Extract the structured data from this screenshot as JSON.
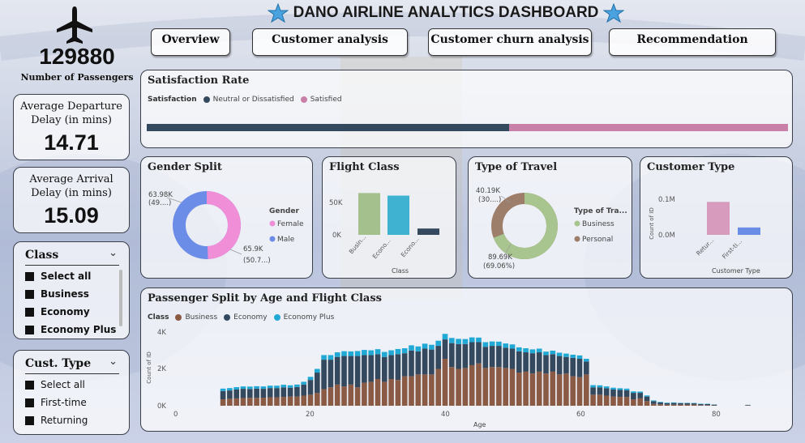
{
  "header": {
    "title": "DANO AIRLINE ANALYTICS DASHBOARD"
  },
  "nav": [
    "Overview",
    "Customer analysis",
    "Customer churn analysis",
    "Recommendation"
  ],
  "passengers": {
    "value": "129880",
    "label": "Number of Passengers"
  },
  "kpis": {
    "departure": {
      "label1": "Average Departure",
      "label2": "Delay (in mins)",
      "value": "14.71"
    },
    "arrival": {
      "label1": "Average Arrival",
      "label2": "Delay (in mins)",
      "value": "15.09"
    }
  },
  "slicer_class": {
    "title": "Class",
    "items": [
      "Select all",
      "Business",
      "Economy",
      "Economy Plus"
    ]
  },
  "slicer_cust": {
    "title": "Cust. Type",
    "items": [
      "Select all",
      "First-time",
      "Returning"
    ]
  },
  "satisfaction": {
    "title": "Satisfaction Rate",
    "legend_title": "Satisfaction",
    "legend": [
      "Neutral or Dissatisfied",
      "Satisfied"
    ],
    "neutral_fraction": 0.565
  },
  "gender": {
    "title": "Gender Split",
    "legend_title": "Gender",
    "legend": [
      "Female",
      "Male"
    ],
    "label_top": "63.98K",
    "label_top2": "(49....)",
    "label_bottom": "65.9K",
    "label_bottom2": "(50.7...)",
    "female_fraction": 0.493
  },
  "flight_class": {
    "title": "Flight Class",
    "xlabel": "Class",
    "yticks": [
      "50K",
      "0K"
    ],
    "cats": [
      "Busin...",
      "Econo...",
      "Econo..."
    ]
  },
  "travel": {
    "title": "Type of Travel",
    "legend_title": "Type of Tra...",
    "legend": [
      "Business",
      "Personal"
    ],
    "label_top": "40.19K",
    "label_top2": "(30....)",
    "label_bottom": "89.69K",
    "label_bottom2": "(69.06%)",
    "business_fraction": 0.6906
  },
  "customer_type": {
    "title": "Customer Type",
    "xlabel": "Customer Type",
    "ylabel": "Count of ID",
    "yticks": [
      "0.1M",
      "0.0M"
    ],
    "cats": [
      "Retur...",
      "First-ti..."
    ]
  },
  "age_chart": {
    "title": "Passenger Split by Age and Flight Class",
    "legend_title": "Class",
    "legend": [
      "Business",
      "Economy",
      "Economy Plus"
    ],
    "xlabel": "Age",
    "ylabel": "Count of ID",
    "yticks": [
      "4K",
      "2K",
      "0K"
    ],
    "xticks": [
      "0",
      "20",
      "40",
      "60",
      "80"
    ]
  },
  "colors": {
    "neutral": "#34495e",
    "satisfied": "#c87fa8",
    "female": "#f08fd8",
    "male": "#6b8de8",
    "cls_business": "#a4c08c",
    "cls_economy": "#3fb1d1",
    "cls_ecoplus": "#34495e",
    "travel_business": "#a8c48f",
    "travel_personal": "#9c7e6b",
    "returning": "#d79cbd",
    "first": "#6b8de8",
    "age_business": "#8a5a44",
    "age_economy": "#34495e",
    "age_ecoplus": "#21a9d6"
  },
  "chart_data": [
    {
      "type": "bar",
      "title": "Flight Class",
      "categories": [
        "Busin...",
        "Econo...",
        "Econo..."
      ],
      "values": [
        62160,
        58309,
        9411
      ],
      "xlabel": "Class",
      "ylim": [
        0,
        65000
      ]
    },
    {
      "type": "bar",
      "title": "Customer Type",
      "categories": [
        "Retur...",
        "First-ti..."
      ],
      "values": [
        106100,
        23780
      ],
      "xlabel": "Customer Type",
      "ylabel": "Count of ID",
      "ylim": [
        0,
        125000
      ]
    },
    {
      "type": "bar",
      "title": "Passenger Split by Age and Flight Class",
      "xlabel": "Age",
      "ylabel": "Count of ID",
      "ylim": [
        0,
        4000
      ],
      "x": [
        7,
        8,
        9,
        10,
        11,
        12,
        13,
        14,
        15,
        16,
        17,
        18,
        19,
        20,
        21,
        22,
        23,
        24,
        25,
        26,
        27,
        28,
        29,
        30,
        31,
        32,
        33,
        34,
        35,
        36,
        37,
        38,
        39,
        40,
        41,
        42,
        43,
        44,
        45,
        46,
        47,
        48,
        49,
        50,
        51,
        52,
        53,
        54,
        55,
        56,
        57,
        58,
        59,
        60,
        61,
        62,
        63,
        64,
        65,
        66,
        67,
        68,
        69,
        70,
        71,
        72,
        73,
        74,
        75,
        76,
        77,
        78,
        79,
        80,
        85
      ],
      "series": [
        {
          "name": "Business",
          "values": [
            350,
            380,
            400,
            420,
            430,
            430,
            440,
            460,
            460,
            480,
            500,
            500,
            550,
            600,
            700,
            900,
            1000,
            1150,
            1050,
            1150,
            1000,
            1250,
            1300,
            1450,
            1300,
            1450,
            1400,
            1600,
            1600,
            1700,
            1700,
            1700,
            2000,
            2550,
            2100,
            2000,
            2050,
            2200,
            2300,
            2050,
            2100,
            2100,
            2050,
            2000,
            1800,
            1850,
            1750,
            1850,
            1750,
            1850,
            1700,
            1750,
            1600,
            1550,
            1700,
            600,
            600,
            550,
            500,
            480,
            480,
            350,
            400,
            250,
            100,
            80,
            60,
            60,
            60,
            60,
            60,
            30,
            30,
            20,
            20
          ]
        },
        {
          "name": "Economy",
          "values": [
            450,
            450,
            480,
            500,
            480,
            500,
            480,
            500,
            500,
            520,
            480,
            520,
            600,
            800,
            1100,
            1600,
            1500,
            1500,
            1650,
            1550,
            1700,
            1500,
            1450,
            1350,
            1350,
            1300,
            1400,
            1250,
            1400,
            1250,
            1400,
            1350,
            1250,
            1050,
            1300,
            1350,
            1300,
            1250,
            1150,
            1150,
            1150,
            1150,
            1100,
            1100,
            1150,
            1050,
            1100,
            1050,
            1000,
            950,
            1000,
            900,
            1000,
            1000,
            700,
            400,
            400,
            400,
            380,
            380,
            360,
            350,
            300,
            250,
            150,
            100,
            80,
            90,
            80,
            80,
            70,
            60,
            60,
            40,
            20
          ]
        },
        {
          "name": "Economy Plus",
          "values": [
            130,
            130,
            130,
            130,
            130,
            130,
            130,
            130,
            130,
            140,
            130,
            130,
            150,
            170,
            200,
            250,
            250,
            250,
            260,
            250,
            270,
            280,
            260,
            270,
            270,
            260,
            280,
            270,
            280,
            270,
            270,
            260,
            280,
            300,
            280,
            280,
            270,
            260,
            250,
            250,
            240,
            230,
            230,
            230,
            220,
            220,
            210,
            200,
            190,
            190,
            180,
            180,
            170,
            180,
            150,
            120,
            110,
            100,
            100,
            90,
            90,
            80,
            70,
            60,
            40,
            30,
            30,
            30,
            20,
            20,
            20,
            20,
            20,
            10,
            10
          ]
        }
      ]
    }
  ]
}
